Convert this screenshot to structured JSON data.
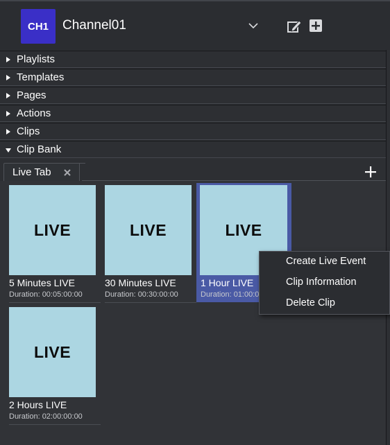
{
  "header": {
    "channel_badge": "CH1",
    "channel_name": "Channel01",
    "badge_color": "#3a2fc7",
    "icons": [
      "chevron-down-icon",
      "edit-icon",
      "add-square-icon"
    ]
  },
  "accordion": {
    "items": [
      {
        "label": "Playlists",
        "expanded": false
      },
      {
        "label": "Templates",
        "expanded": false
      },
      {
        "label": "Pages",
        "expanded": false
      },
      {
        "label": "Actions",
        "expanded": false
      },
      {
        "label": "Clips",
        "expanded": false
      },
      {
        "label": "Clip Bank",
        "expanded": true
      }
    ]
  },
  "clip_bank": {
    "tabs": [
      {
        "label": "Live Tab",
        "active": true
      }
    ],
    "clips": [
      {
        "thumb_text": "LIVE",
        "name": "5 Minutes LIVE",
        "duration": "Duration: 00:05:00:00",
        "selected": false
      },
      {
        "thumb_text": "LIVE",
        "name": "30 Minutes LIVE",
        "duration": "Duration: 00:30:00:00",
        "selected": false
      },
      {
        "thumb_text": "LIVE",
        "name": "1 Hour LIVE",
        "duration": "Duration: 01:00:00:00",
        "selected": true
      },
      {
        "thumb_text": "LIVE",
        "name": "2 Hours LIVE",
        "duration": "Duration: 02:00:00:00",
        "selected": false
      }
    ],
    "thumb_color": "#acd6e2",
    "selection_color": "#4a5aa5"
  },
  "context_menu": {
    "items": [
      {
        "label": "Create Live Event"
      },
      {
        "label": "Clip Information"
      },
      {
        "label": "Delete Clip"
      }
    ]
  }
}
